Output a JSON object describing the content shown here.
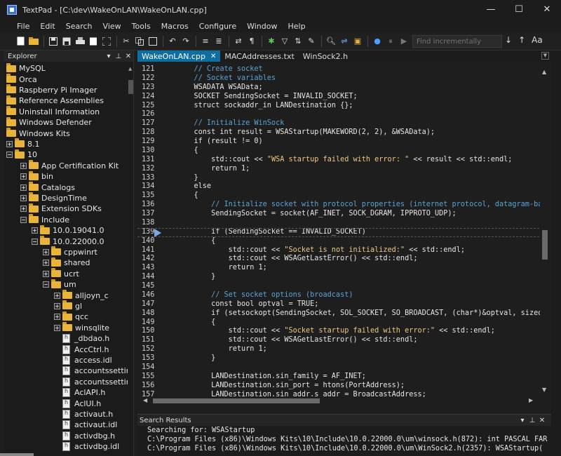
{
  "window": {
    "title": "TextPad - [C:\\dev\\WakeOnLAN\\WakeOnLAN.cpp]",
    "controls": [
      "—",
      "☐",
      "✕"
    ]
  },
  "menu": [
    "File",
    "Edit",
    "Search",
    "View",
    "Tools",
    "Macros",
    "Configure",
    "Window",
    "Help"
  ],
  "toolbar": {
    "icons": [
      "new-file-icon",
      "open-folder-icon",
      "save-icon",
      "save-all-icon",
      "print-icon",
      "print-preview-icon",
      "cut-icon",
      "copy-icon",
      "paste-icon",
      "undo-icon",
      "redo-icon",
      "indent-icon",
      "outdent-icon",
      "word-wrap-icon",
      "pilcrow-icon",
      "spell-check-icon",
      "filter-icon",
      "sort-icon",
      "format-icon",
      "find-icon",
      "replace-icon",
      "find-in-files-icon",
      "record-macro-icon",
      "pause-macro-icon",
      "play-macro-icon"
    ],
    "find_placeholder": "Find incrementally",
    "right_labels": [
      "↓",
      "↑",
      "Aa"
    ]
  },
  "explorer": {
    "title": "Explorer",
    "items": [
      {
        "label": "MySQL",
        "level": 0,
        "expander": "",
        "type": "folder"
      },
      {
        "label": "Orca",
        "level": 0,
        "expander": "",
        "type": "folder"
      },
      {
        "label": "Raspberry Pi Imager",
        "level": 0,
        "expander": "",
        "type": "folder"
      },
      {
        "label": "Reference Assemblies",
        "level": 0,
        "expander": "",
        "type": "folder"
      },
      {
        "label": "Uninstall Information",
        "level": 0,
        "expander": "",
        "type": "folder"
      },
      {
        "label": "Windows Defender",
        "level": 0,
        "expander": "",
        "type": "folder"
      },
      {
        "label": "Windows Kits",
        "level": 0,
        "expander": "",
        "type": "folder"
      },
      {
        "label": "8.1",
        "level": 1,
        "expander": "+",
        "type": "folder"
      },
      {
        "label": "10",
        "level": 1,
        "expander": "−",
        "type": "folder"
      },
      {
        "label": "App Certification Kit",
        "level": 2,
        "expander": "+",
        "type": "folder"
      },
      {
        "label": "bin",
        "level": 2,
        "expander": "+",
        "type": "folder"
      },
      {
        "label": "Catalogs",
        "level": 2,
        "expander": "+",
        "type": "folder"
      },
      {
        "label": "DesignTime",
        "level": 2,
        "expander": "+",
        "type": "folder"
      },
      {
        "label": "Extension SDKs",
        "level": 2,
        "expander": "+",
        "type": "folder"
      },
      {
        "label": "Include",
        "level": 2,
        "expander": "−",
        "type": "folder"
      },
      {
        "label": "10.0.19041.0",
        "level": 3,
        "expander": "+",
        "type": "folder"
      },
      {
        "label": "10.0.22000.0",
        "level": 3,
        "expander": "−",
        "type": "folder"
      },
      {
        "label": "cppwinrt",
        "level": 4,
        "expander": "+",
        "type": "folder"
      },
      {
        "label": "shared",
        "level": 4,
        "expander": "+",
        "type": "folder"
      },
      {
        "label": "ucrt",
        "level": 4,
        "expander": "+",
        "type": "folder"
      },
      {
        "label": "um",
        "level": 4,
        "expander": "−",
        "type": "folder"
      },
      {
        "label": "alljoyn_c",
        "level": 5,
        "expander": "+",
        "type": "folder"
      },
      {
        "label": "gl",
        "level": 5,
        "expander": "+",
        "type": "folder"
      },
      {
        "label": "qcc",
        "level": 5,
        "expander": "+",
        "type": "folder"
      },
      {
        "label": "winsqlite",
        "level": 5,
        "expander": "+",
        "type": "folder"
      },
      {
        "label": "_dbdao.h",
        "level": 5,
        "expander": "",
        "type": "file"
      },
      {
        "label": "AccCtrl.h",
        "level": 5,
        "expander": "",
        "type": "file"
      },
      {
        "label": "access.idl",
        "level": 5,
        "expander": "",
        "type": "file"
      },
      {
        "label": "accountssettin",
        "level": 5,
        "expander": "",
        "type": "file"
      },
      {
        "label": "accountssettin",
        "level": 5,
        "expander": "",
        "type": "file"
      },
      {
        "label": "AclAPI.h",
        "level": 5,
        "expander": "",
        "type": "file"
      },
      {
        "label": "AclUI.h",
        "level": 5,
        "expander": "",
        "type": "file"
      },
      {
        "label": "activaut.h",
        "level": 5,
        "expander": "",
        "type": "file"
      },
      {
        "label": "activaut.idl",
        "level": 5,
        "expander": "",
        "type": "file"
      },
      {
        "label": "activdbg.h",
        "level": 5,
        "expander": "",
        "type": "file"
      },
      {
        "label": "activdbg.idl",
        "level": 5,
        "expander": "",
        "type": "file"
      }
    ]
  },
  "tabs": [
    {
      "label": "WakeOnLAN.cpp",
      "active": true,
      "close": "✕"
    },
    {
      "label": "MACAddresses.txt",
      "active": false,
      "close": ""
    },
    {
      "label": "WinSock2.h",
      "active": false,
      "close": ""
    }
  ],
  "editor": {
    "bookmark_line": "139",
    "lines": [
      {
        "n": "121",
        "t": "    // Create socket",
        "k": "comment"
      },
      {
        "n": "122",
        "t": "    // Socket variables",
        "k": "comment"
      },
      {
        "n": "123",
        "t": "    WSADATA WSAData;",
        "k": ""
      },
      {
        "n": "124",
        "t": "    SOCKET SendingSocket = INVALID_SOCKET;",
        "k": ""
      },
      {
        "n": "125",
        "t": "    struct sockaddr_in LANDestination {};",
        "k": ""
      },
      {
        "n": "126",
        "t": "",
        "k": ""
      },
      {
        "n": "127",
        "t": "    // Initialize WinSock",
        "k": "comment"
      },
      {
        "n": "128",
        "t": "    const int result = WSAStartup(MAKEWORD(2, 2), &WSAData);",
        "k": ""
      },
      {
        "n": "129",
        "t": "    if (result != 0)",
        "k": ""
      },
      {
        "n": "130",
        "t": "    {",
        "k": ""
      },
      {
        "n": "131",
        "t": "        std::cout << \"WSA startup failed with error: \" << result << std::endl;",
        "k": "string",
        "pre": "        std::cout << ",
        "str": "\"WSA startup failed with error: \"",
        "post": " << result << std::endl;"
      },
      {
        "n": "132",
        "t": "        return 1;",
        "k": ""
      },
      {
        "n": "133",
        "t": "    }",
        "k": ""
      },
      {
        "n": "134",
        "t": "    else",
        "k": ""
      },
      {
        "n": "135",
        "t": "    {",
        "k": ""
      },
      {
        "n": "136",
        "t": "        // Initialize socket with protocol properties (internet protocol, datagram-based",
        "k": "comment"
      },
      {
        "n": "137",
        "t": "        SendingSocket = socket(AF_INET, SOCK_DGRAM, IPPROTO_UDP);",
        "k": ""
      },
      {
        "n": "138",
        "t": "",
        "k": ""
      },
      {
        "n": "139",
        "t": "        if (SendingSocket == INVALID_SOCKET)",
        "k": ""
      },
      {
        "n": "140",
        "t": "        {",
        "k": ""
      },
      {
        "n": "141",
        "t": "            std::cout << \"Socket is not initialized:\" << std::endl;",
        "k": "string",
        "pre": "            std::cout << ",
        "str": "\"Socket is not initialized:\"",
        "post": " << std::endl;"
      },
      {
        "n": "142",
        "t": "            std::cout << WSAGetLastError() << std::endl;",
        "k": ""
      },
      {
        "n": "143",
        "t": "            return 1;",
        "k": ""
      },
      {
        "n": "144",
        "t": "        }",
        "k": ""
      },
      {
        "n": "145",
        "t": "",
        "k": ""
      },
      {
        "n": "146",
        "t": "        // Set socket options (broadcast)",
        "k": "comment"
      },
      {
        "n": "147",
        "t": "        const bool optval = TRUE;",
        "k": ""
      },
      {
        "n": "148",
        "t": "        if (setsockopt(SendingSocket, SOL_SOCKET, SO_BROADCAST, (char*)&optval, sizeof(op",
        "k": ""
      },
      {
        "n": "149",
        "t": "        {",
        "k": ""
      },
      {
        "n": "150",
        "t": "            std::cout << \"Socket startup failed with error:\" << std::endl;",
        "k": "string",
        "pre": "            std::cout << ",
        "str": "\"Socket startup failed with error:\"",
        "post": " << std::endl;"
      },
      {
        "n": "151",
        "t": "            std::cout << WSAGetLastError() << std::endl;",
        "k": ""
      },
      {
        "n": "152",
        "t": "            return 1;",
        "k": ""
      },
      {
        "n": "153",
        "t": "        }",
        "k": ""
      },
      {
        "n": "154",
        "t": "",
        "k": ""
      },
      {
        "n": "155",
        "t": "        LANDestination.sin_family = AF_INET;",
        "k": ""
      },
      {
        "n": "156",
        "t": "        LANDestination.sin_port = htons(PortAddress);",
        "k": ""
      },
      {
        "n": "157",
        "t": "        LANDestination.sin_addr.s_addr = BroadcastAddress;",
        "k": ""
      }
    ]
  },
  "search_results": {
    "title": "Search Results",
    "lines": [
      "Searching for: WSAStartup",
      "C:\\Program Files (x86)\\Windows Kits\\10\\Include\\10.0.22000.0\\um\\winsock.h(872): int PASCAL FAR",
      "C:\\Program Files (x86)\\Windows Kits\\10\\Include\\10.0.22000.0\\um\\WinSock2.h(2357): WSAStartup("
    ]
  },
  "colors": {
    "accent_tab": "#0f6ea0",
    "comment": "#5aa4d6",
    "string": "#efc983",
    "folder": "#e8b53a"
  }
}
